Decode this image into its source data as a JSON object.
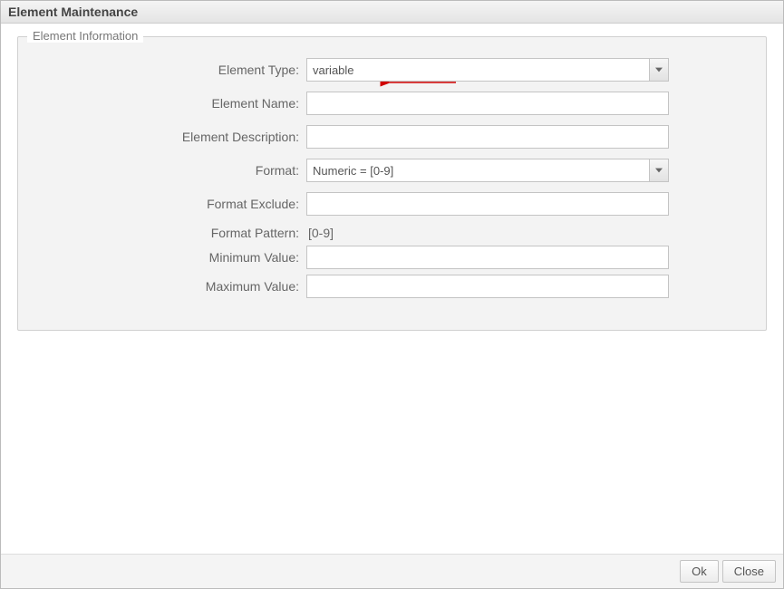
{
  "dialog": {
    "title": "Element Maintenance"
  },
  "fieldset": {
    "legend": "Element Information"
  },
  "form": {
    "element_type": {
      "label": "Element Type:",
      "value": "variable"
    },
    "element_name": {
      "label": "Element Name:",
      "value": ""
    },
    "element_description": {
      "label": "Element Description:",
      "value": ""
    },
    "format": {
      "label": "Format:",
      "value": "Numeric = [0-9]"
    },
    "format_exclude": {
      "label": "Format Exclude:",
      "value": ""
    },
    "format_pattern": {
      "label": "Format Pattern:",
      "value": "[0-9]"
    },
    "minimum_value": {
      "label": "Minimum Value:",
      "value": ""
    },
    "maximum_value": {
      "label": "Maximum Value:",
      "value": ""
    }
  },
  "buttons": {
    "ok": "Ok",
    "close": "Close"
  }
}
